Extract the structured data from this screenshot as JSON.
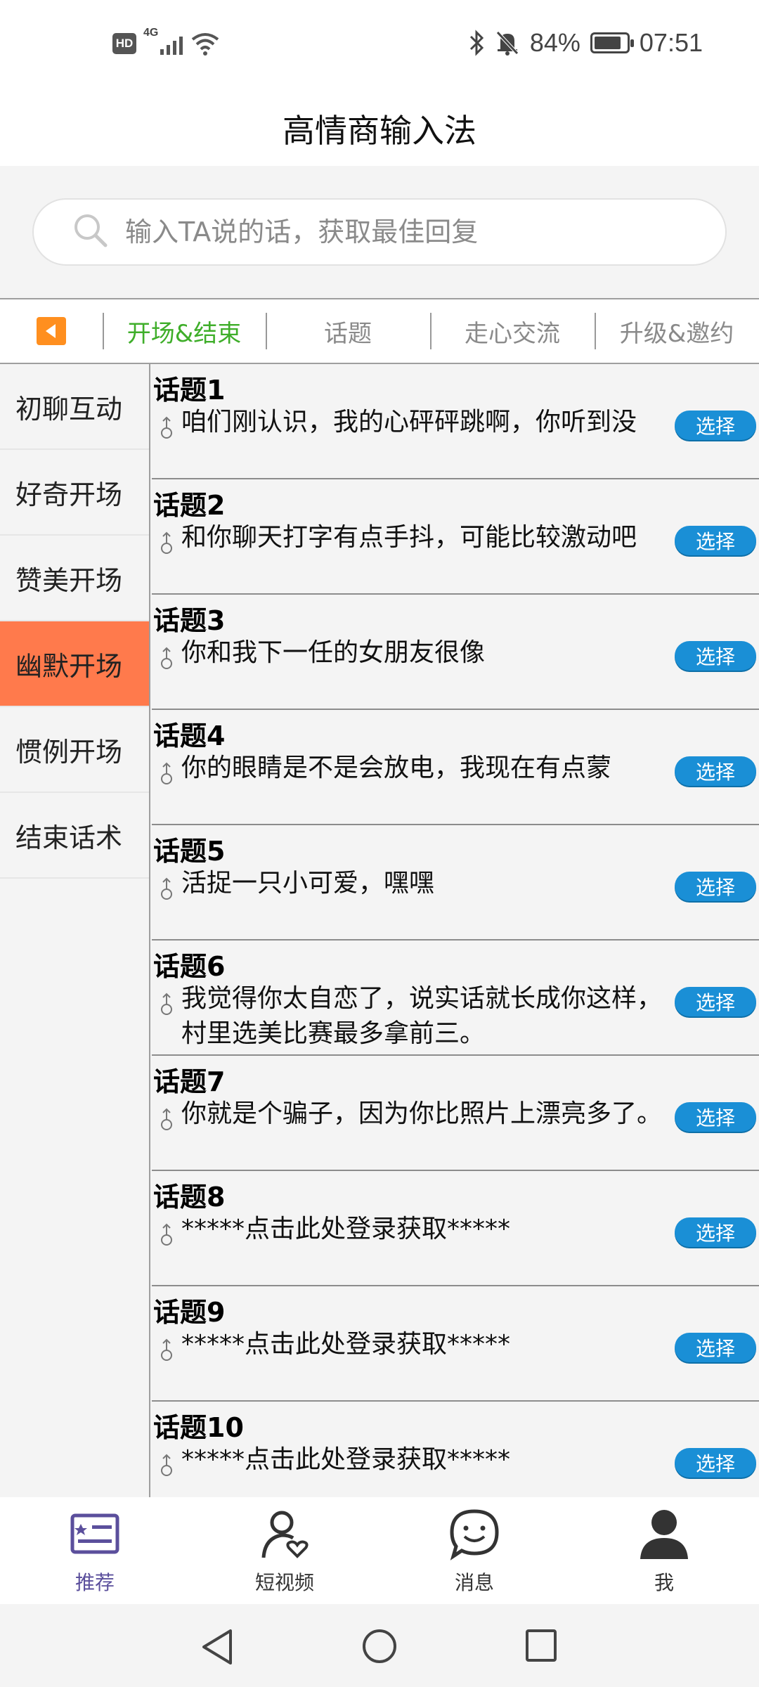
{
  "status_bar": {
    "hd": "HD",
    "network": "4G",
    "battery_percent": "84%",
    "battery_level": 0.84,
    "time": "07:51"
  },
  "app_title": "高情商输入法",
  "search": {
    "placeholder": "输入TA说的话，获取最佳回复"
  },
  "tabs": [
    {
      "label": "开场&结束",
      "active": true
    },
    {
      "label": "话题",
      "active": false
    },
    {
      "label": "走心交流",
      "active": false
    },
    {
      "label": "升级&邀约",
      "active": false
    }
  ],
  "sidebar": {
    "items": [
      {
        "label": "初聊互动",
        "active": false
      },
      {
        "label": "好奇开场",
        "active": false
      },
      {
        "label": "赞美开场",
        "active": false
      },
      {
        "label": "幽默开场",
        "active": true
      },
      {
        "label": "惯例开场",
        "active": false
      },
      {
        "label": "结束话术",
        "active": false
      }
    ]
  },
  "select_label": "选择",
  "topics": [
    {
      "title": "话题1",
      "text": "咱们刚认识，我的心砰砰跳啊，你听到没"
    },
    {
      "title": "话题2",
      "text": "和你聊天打字有点手抖，可能比较激动吧"
    },
    {
      "title": "话题3",
      "text": "你和我下一任的女朋友很像"
    },
    {
      "title": "话题4",
      "text": "你的眼睛是不是会放电，我现在有点蒙"
    },
    {
      "title": "话题5",
      "text": "活捉一只小可爱，嘿嘿"
    },
    {
      "title": "话题6",
      "text": "我觉得你太自恋了，说实话就长成你这样，村里选美比赛最多拿前三。"
    },
    {
      "title": "话题7",
      "text": "你就是个骗子，因为你比照片上漂亮多了。"
    },
    {
      "title": "话题8",
      "text": "*****点击此处登录获取*****"
    },
    {
      "title": "话题9",
      "text": "*****点击此处登录获取*****"
    },
    {
      "title": "话题10",
      "text": "*****点击此处登录获取*****"
    }
  ],
  "bottom_tabs": [
    {
      "label": "推荐",
      "icon": "recommend-list-icon",
      "active": true
    },
    {
      "label": "短视频",
      "icon": "person-heart-icon",
      "active": false
    },
    {
      "label": "消息",
      "icon": "chat-bubble-icon",
      "active": false
    },
    {
      "label": "我",
      "icon": "user-profile-icon",
      "active": false
    }
  ],
  "colors": {
    "active_tab": "#3fae2a",
    "active_side": "#ff7a4c",
    "select_button": "#1a8fd6",
    "back_button": "#ff8f1f",
    "active_bottom_tab": "#5b4f9c"
  }
}
